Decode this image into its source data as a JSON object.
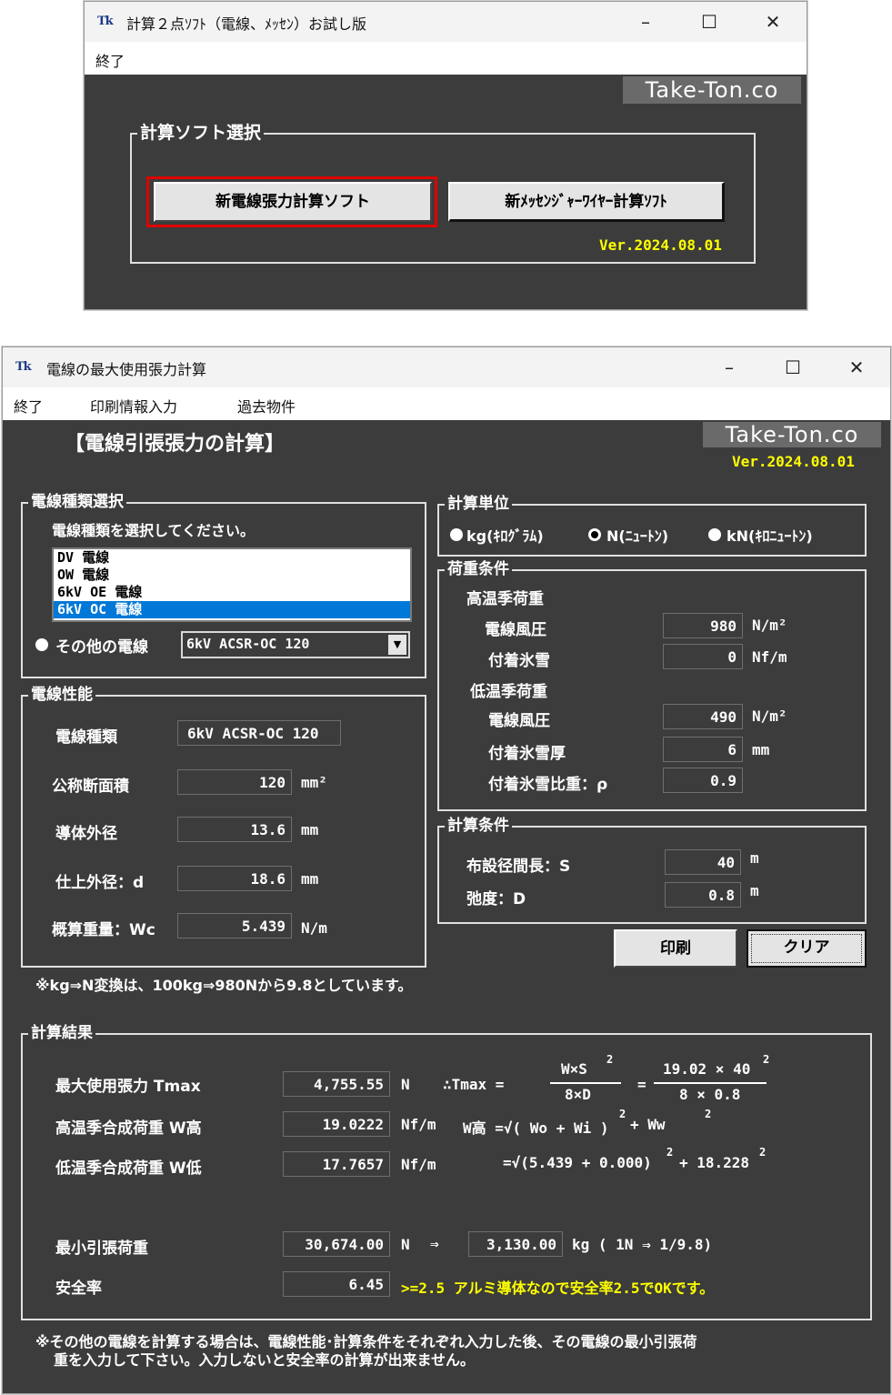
{
  "window1": {
    "title": "計算２点ｿﾌﾄ（電線、ﾒｯｾﾝ）お試し版",
    "menu": [
      "終了"
    ],
    "brand": "Take-Ton.co",
    "group_title": "計算ソフト選択",
    "button_denshen": "新電線張力計算ソフト",
    "button_messenger": "新ﾒｯｾﾝｼﾞｬｰﾜｲﾔｰ計算ｿﾌﾄ",
    "version": "Ver.2024.08.01"
  },
  "window2": {
    "title": "電線の最大使用張力計算",
    "menu": [
      "終了",
      "印刷情報入力",
      "過去物件"
    ],
    "brand": "Take-Ton.co",
    "version": "Ver.2024.08.01",
    "heading": "【電線引張張力の計算】",
    "wire_select": {
      "legend": "電線種類選択",
      "instruction": "電線種類を選択してください。",
      "items": [
        "DV 電線",
        "OW 電線",
        "6kV OE 電線",
        "6kV OC 電線"
      ],
      "selected_index": 3,
      "other_label": "その他の電線",
      "other_value": "6kV ACSR-OC 120"
    },
    "wire_perf": {
      "legend": "電線性能",
      "type_label": "電線種類",
      "type_value": "6kV ACSR-OC 120",
      "area_label": "公称断面積",
      "area_value": "120",
      "area_unit": "mm²",
      "cond_label": "導体外径",
      "cond_value": "13.6",
      "cond_unit": "mm",
      "outer_label": "仕上外径：d",
      "outer_value": "18.6",
      "outer_unit": "mm",
      "weight_label": "概算重量：Wc",
      "weight_value": "5.439",
      "weight_unit": "N/m"
    },
    "note_kg": "※kg⇒N変換は、100kg⇒980Nから9.8としています。",
    "units": {
      "legend": "計算単位",
      "options": [
        "kg(ｷﾛｸﾞﾗﾑ)",
        "N(ﾆｭｰﾄﾝ)",
        "kN(ｷﾛﾆｭｰﾄﾝ)"
      ],
      "selected_index": 1
    },
    "load": {
      "legend": "荷重条件",
      "high_title": "高温季荷重",
      "wind_label": "電線風圧",
      "wind_value": "980",
      "wind_unit": "N/m²",
      "ice_label": "付着氷雪",
      "ice_value": "0",
      "ice_unit": "Nf/m",
      "low_title": "低温季荷重",
      "wind2_label": "電線風圧",
      "wind2_value": "490",
      "wind2_unit": "N/m²",
      "thick_label": "付着氷雪厚",
      "thick_value": "6",
      "thick_unit": "mm",
      "density_label": "付着氷雪比重：ρ",
      "density_value": "0.9"
    },
    "calc": {
      "legend": "計算条件",
      "span_label": "布設径間長：S",
      "span_value": "40",
      "span_unit": "m",
      "sag_label": "弛度：D",
      "sag_value": "0.8",
      "sag_unit": "m"
    },
    "print_button": "印刷",
    "clear_button": "クリア",
    "result": {
      "legend": "計算結果",
      "tmax_label": "最大使用張力 Tmax",
      "tmax_value": "4,755.55",
      "tmax_unit": "N",
      "whigh_label": "高温季合成荷重 W高",
      "whigh_value": "19.0222",
      "whigh_unit": "Nf/m",
      "wlow_label": "低温季合成荷重 W低",
      "wlow_value": "17.7657",
      "wlow_unit": "Nf/m",
      "f_therefore": "∴Tmax =",
      "f_num": "W×S",
      "f_sq": "2",
      "f_den": "8×D",
      "f_eq": "=",
      "f_num2": "19.02 × 40",
      "f_sq2": "2",
      "f_den2": "8  × 0.8",
      "f_whigh": "W高 =√( Wo + Wi )",
      "f_whigh_sq": "2",
      "f_whigh_tail": "+  Ww",
      "f_whigh_sq2": "2",
      "f_wlow": "=√(5.439  + 0.000)",
      "f_wlow_sq": "2",
      "f_wlow_tail": "+  18.228",
      "f_wlow_sq2": "2",
      "minload_label": "最小引張荷重",
      "minload_value": "30,674.00",
      "minload_unit": "N",
      "arrow": "⇒",
      "minload_kg": "3,130.00",
      "minload_kg_unit": "kg ( 1N ⇒ 1/9.8)",
      "safety_label": "安全率",
      "safety_value": "6.45",
      "safety_note": ">=2.5 アルミ導体なので安全率2.5でOKです。"
    },
    "footer_note_1": "※その他の電線を計算する場合は、電線性能･計算条件をそれぞれ入力した後、その電線の最小引張荷",
    "footer_note_2": "重を入力して下さい。入力しないと安全率の計算が出来ません。"
  },
  "colors": {
    "panel_bg": "#3c3c3c",
    "selection": "#0078d7",
    "highlight_border": "#e00000",
    "version_text": "#ffff00"
  }
}
